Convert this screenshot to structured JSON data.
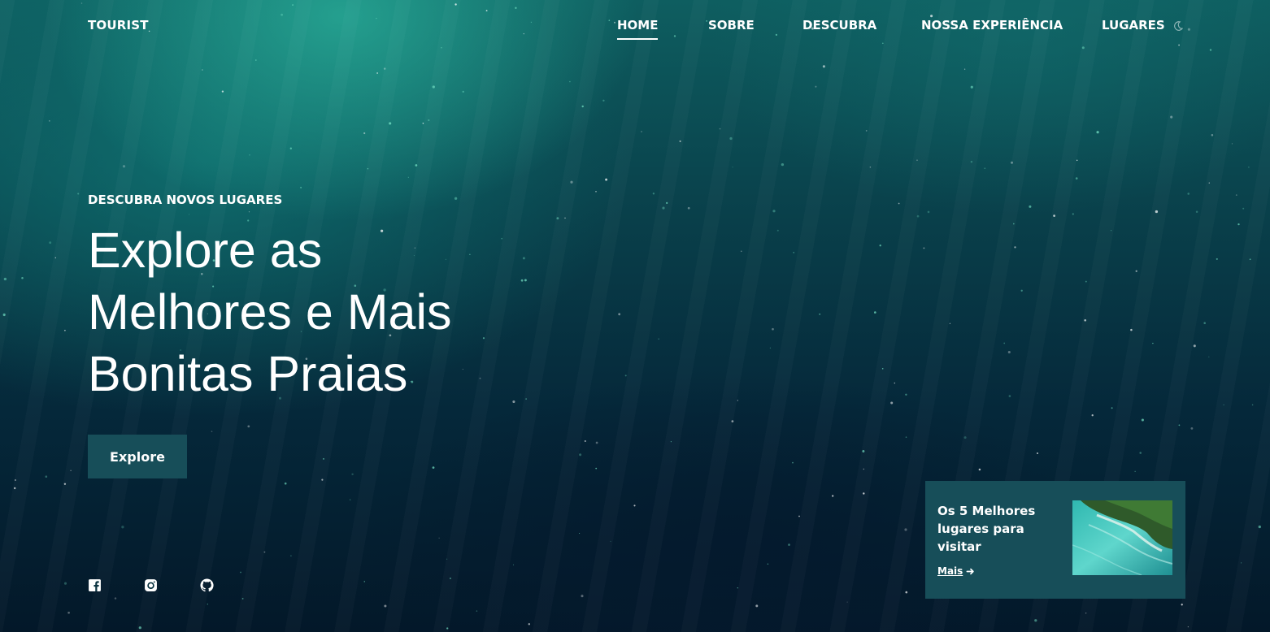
{
  "header": {
    "logo": "TOURIST",
    "nav": [
      {
        "label": "HOME",
        "active": true
      },
      {
        "label": "SOBRE",
        "active": false
      },
      {
        "label": "DESCUBRA",
        "active": false
      },
      {
        "label": "NOSSA EXPERIÊNCIA",
        "active": false
      },
      {
        "label": "LUGARES",
        "active": false
      }
    ],
    "theme_icon": "moon-icon"
  },
  "hero": {
    "subtitle": "DESCUBRA NOVOS LUGARES",
    "title_lines": [
      "Explore as",
      "Melhores e Mais",
      "Bonitas Praias"
    ],
    "button_label": "Explore"
  },
  "social": [
    {
      "icon": "facebook-icon"
    },
    {
      "icon": "instagram-icon"
    },
    {
      "icon": "github-icon"
    }
  ],
  "card": {
    "title": "Os 5 Melhores lugares para visitar",
    "link_label": "Mais",
    "link_icon": "arrow-right-icon",
    "image_icon": "beach-thumbnail"
  },
  "colors": {
    "accent": "#174e59",
    "text": "#ffffff"
  }
}
